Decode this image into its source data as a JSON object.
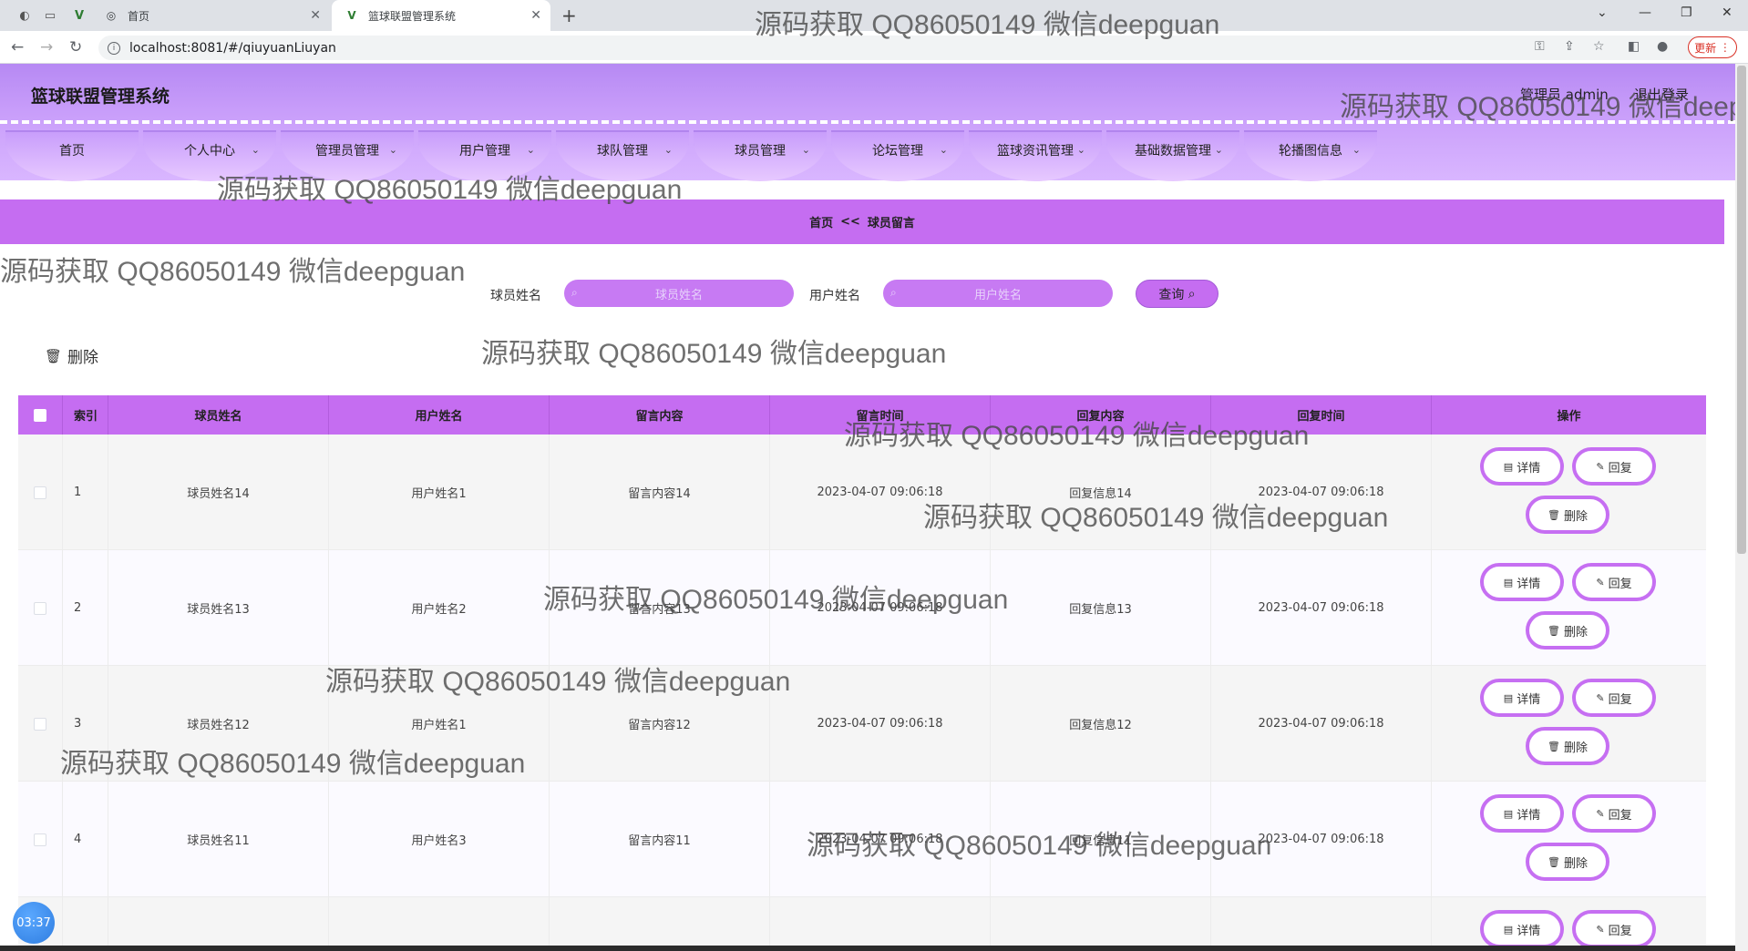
{
  "browser": {
    "tabs": [
      {
        "title": "首页",
        "icon": "globe-icon"
      },
      {
        "title": "篮球联盟管理系统",
        "icon": "vue-icon"
      }
    ],
    "url": "localhost:8081/#/qiuyuanLiuyan",
    "update_label": "更新"
  },
  "header": {
    "title": "篮球联盟管理系统",
    "user": "管理员 admin",
    "logout": "退出登录"
  },
  "menu": [
    {
      "label": "首页",
      "has_dropdown": false
    },
    {
      "label": "个人中心",
      "has_dropdown": true
    },
    {
      "label": "管理员管理",
      "has_dropdown": true
    },
    {
      "label": "用户管理",
      "has_dropdown": true
    },
    {
      "label": "球队管理",
      "has_dropdown": true
    },
    {
      "label": "球员管理",
      "has_dropdown": true
    },
    {
      "label": "论坛管理",
      "has_dropdown": true
    },
    {
      "label": "篮球资讯管理",
      "has_dropdown": true
    },
    {
      "label": "基础数据管理",
      "has_dropdown": true
    },
    {
      "label": "轮播图信息",
      "has_dropdown": true
    }
  ],
  "breadcrumb": {
    "home": "首页",
    "sep": "<<",
    "current": "球员留言"
  },
  "search": {
    "player_label": "球员姓名",
    "player_placeholder": "球员姓名",
    "user_label": "用户姓名",
    "user_placeholder": "用户姓名",
    "query_label": "查询"
  },
  "toolbar": {
    "delete_label": "删除"
  },
  "table": {
    "columns": [
      "索引",
      "球员姓名",
      "用户姓名",
      "留言内容",
      "留言时间",
      "回复内容",
      "回复时间",
      "操作"
    ],
    "rows": [
      {
        "index": "1",
        "player": "球员姓名14",
        "user": "用户姓名1",
        "content": "留言内容14",
        "msg_time": "2023-04-07 09:06:18",
        "reply": "回复信息14",
        "reply_time": "2023-04-07 09:06:18"
      },
      {
        "index": "2",
        "player": "球员姓名13",
        "user": "用户姓名2",
        "content": "留言内容13",
        "msg_time": "2023-04-07 09:06:18",
        "reply": "回复信息13",
        "reply_time": "2023-04-07 09:06:18"
      },
      {
        "index": "3",
        "player": "球员姓名12",
        "user": "用户姓名1",
        "content": "留言内容12",
        "msg_time": "2023-04-07 09:06:18",
        "reply": "回复信息12",
        "reply_time": "2023-04-07 09:06:18"
      },
      {
        "index": "4",
        "player": "球员姓名11",
        "user": "用户姓名3",
        "content": "留言内容11",
        "msg_time": "2023-04-07 09:06:18",
        "reply": "回复信息11",
        "reply_time": "2023-04-07 09:06:18"
      }
    ],
    "actions": {
      "detail": "详情",
      "reply": "回复",
      "delete": "删除"
    }
  },
  "watermark": "源码获取 QQ86050149 微信deepguan",
  "clock": "03:37",
  "colors": {
    "accent": "#c56df1",
    "header": "#b689f3",
    "button_border": "#c66ff2"
  }
}
